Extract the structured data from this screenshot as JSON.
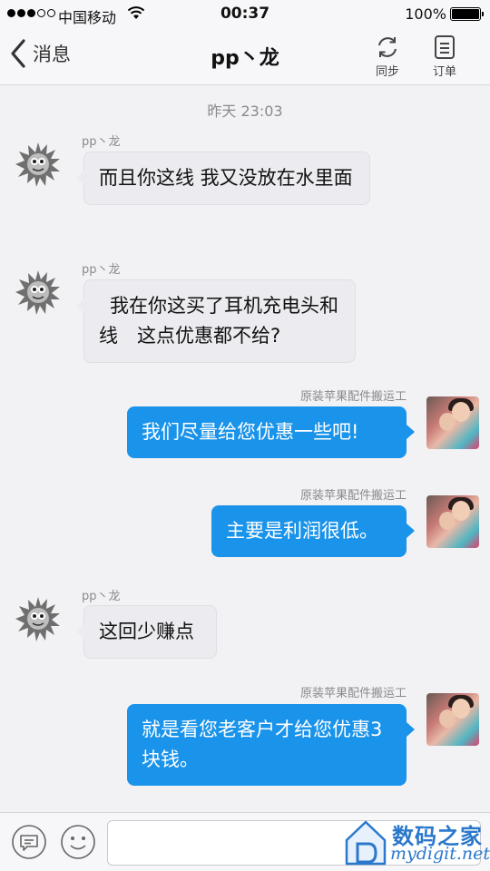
{
  "status_bar": {
    "carrier": "中国移动",
    "time": "00:37",
    "battery": "100%",
    "battery_level": 1.0,
    "signal_bars": 3,
    "signal_total": 5
  },
  "nav": {
    "back_label": "消息",
    "title": "pp丶龙",
    "sync_label": "同步",
    "order_label": "订单"
  },
  "chat": {
    "timestamp": "昨天 23:03",
    "messages": [
      {
        "sender": "pp丶龙",
        "direction": "in",
        "text": "而且你这线 我又没放在水里面"
      },
      {
        "sender": "pp丶龙",
        "direction": "in",
        "text": "我在你这买了耳机充电头和线　这点优惠都不给?"
      },
      {
        "sender": "原装苹果配件搬运工",
        "direction": "out",
        "text": "我们尽量给您优惠一些吧!"
      },
      {
        "sender": "原装苹果配件搬运工",
        "direction": "out",
        "text": "主要是利润很低。"
      },
      {
        "sender": "pp丶龙",
        "direction": "in",
        "text": "这回少赚点"
      },
      {
        "sender": "原装苹果配件搬运工",
        "direction": "out",
        "text": "就是看您老客户才给您优惠3块钱。"
      }
    ]
  },
  "input_bar": {
    "message_value": "",
    "icons": [
      "message-bubble-icon",
      "emoji-icon"
    ]
  },
  "watermark": {
    "cn": "数码之家",
    "en": "mydigit.net"
  },
  "colors": {
    "outgoing_bubble": "#1a93ea",
    "incoming_bubble": "#ebebf0",
    "watermark": "#2a78cc"
  }
}
